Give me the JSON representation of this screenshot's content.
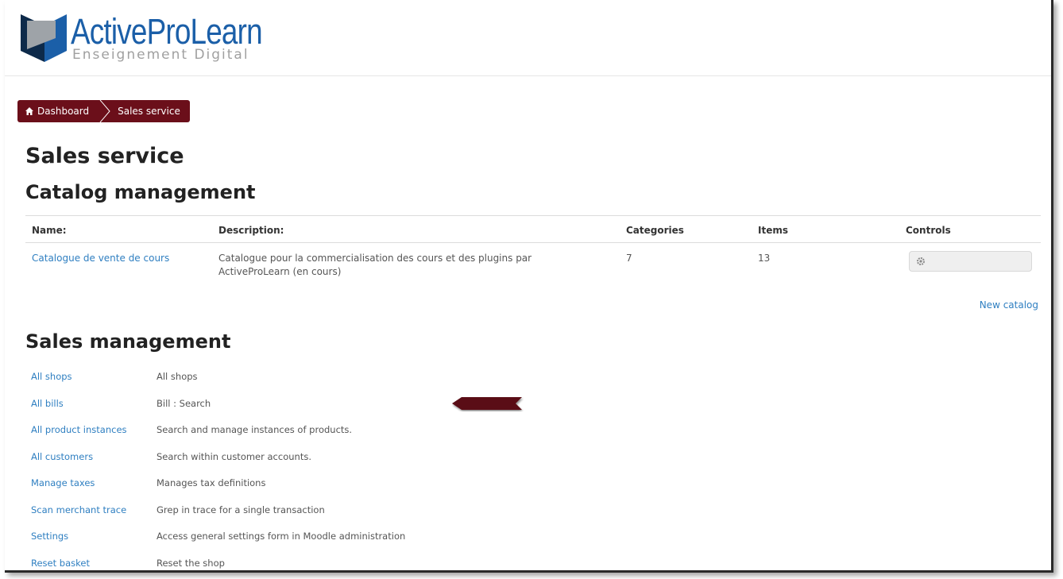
{
  "header": {
    "logo_name": "ActiveProLearn",
    "logo_sub": "Enseignement Digital"
  },
  "breadcrumb": {
    "items": [
      {
        "label": "Dashboard",
        "icon": "home-icon"
      },
      {
        "label": "Sales service"
      }
    ]
  },
  "page": {
    "title": "Sales service",
    "catalog_heading": "Catalog management",
    "sales_heading": "Sales management",
    "new_catalog": "New catalog"
  },
  "catalog_table": {
    "headers": [
      "Name:",
      "Description:",
      "Categories",
      "Items",
      "Controls"
    ],
    "rows": [
      {
        "name": "Catalogue de vente de cours",
        "description": "Catalogue  pour la commercialisation des cours et des plugins par ActiveProLearn (en cours)",
        "categories": "7",
        "items": "13",
        "control_icon": "gear-icon"
      }
    ]
  },
  "sales_management": [
    {
      "link": "All shops",
      "desc": "All shops"
    },
    {
      "link": "All bills",
      "desc": "Bill : Search"
    },
    {
      "link": "All product instances",
      "desc": "Search and manage instances of products."
    },
    {
      "link": "All customers",
      "desc": "Search within customer accounts."
    },
    {
      "link": "Manage taxes",
      "desc": "Manages tax definitions"
    },
    {
      "link": "Scan merchant trace",
      "desc": "Grep in trace for a single transaction"
    },
    {
      "link": "Settings",
      "desc": "Access general settings form in Moodle administration"
    },
    {
      "link": "Reset basket",
      "desc": "Reset the shop"
    }
  ],
  "colors": {
    "brand_blue": "#1b5fa8",
    "breadcrumb_bg": "#6b0f1a",
    "link": "#2f7fc1"
  }
}
